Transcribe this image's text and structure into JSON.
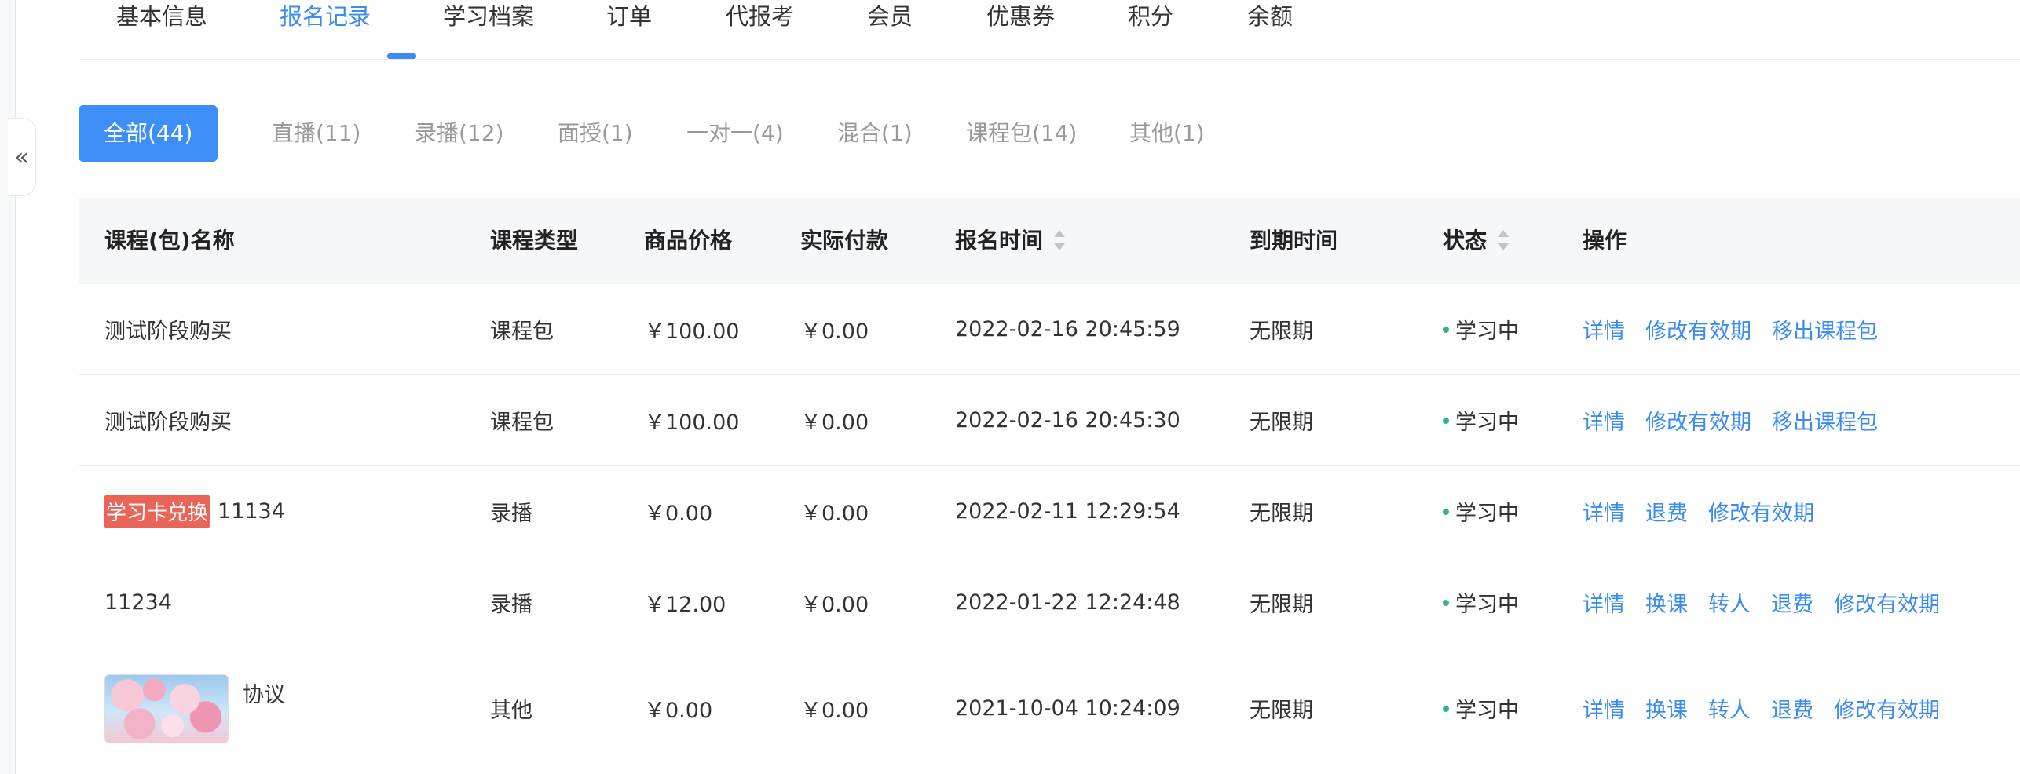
{
  "sidebar": {
    "collapse_label": "«"
  },
  "tabs": [
    {
      "label": "基本信息"
    },
    {
      "label": "报名记录"
    },
    {
      "label": "学习档案"
    },
    {
      "label": "订单"
    },
    {
      "label": "代报考"
    },
    {
      "label": "会员"
    },
    {
      "label": "优惠券"
    },
    {
      "label": "积分"
    },
    {
      "label": "余额"
    }
  ],
  "filters": [
    {
      "label": "全部(44)"
    },
    {
      "label": "直播(11)"
    },
    {
      "label": "录播(12)"
    },
    {
      "label": "面授(1)"
    },
    {
      "label": "一对一(4)"
    },
    {
      "label": "混合(1)"
    },
    {
      "label": "课程包(14)"
    },
    {
      "label": "其他(1)"
    }
  ],
  "table": {
    "headers": [
      "课程(包)名称",
      "课程类型",
      "商品价格",
      "实际付款",
      "报名时间",
      "到期时间",
      "状态",
      "操作"
    ],
    "rows": [
      {
        "name": "测试阶段购买",
        "type": "课程包",
        "price": "￥100.00",
        "paid": "￥0.00",
        "enroll_time": "2022-02-16 20:45:59",
        "expire": "无限期",
        "status": "学习中",
        "actions": [
          "详情",
          "修改有效期",
          "移出课程包"
        ]
      },
      {
        "name": "测试阶段购买",
        "type": "课程包",
        "price": "￥100.00",
        "paid": "￥0.00",
        "enroll_time": "2022-02-16 20:45:30",
        "expire": "无限期",
        "status": "学习中",
        "actions": [
          "详情",
          "修改有效期",
          "移出课程包"
        ]
      },
      {
        "badge": "学习卡兑换",
        "name": "11134",
        "type": "录播",
        "price": "￥0.00",
        "paid": "￥0.00",
        "enroll_time": "2022-02-11 12:29:54",
        "expire": "无限期",
        "status": "学习中",
        "actions": [
          "详情",
          "退费",
          "修改有效期"
        ]
      },
      {
        "name": "11234",
        "type": "录播",
        "price": "￥12.00",
        "paid": "￥0.00",
        "enroll_time": "2022-01-22 12:24:48",
        "expire": "无限期",
        "status": "学习中",
        "actions": [
          "详情",
          "换课",
          "转人",
          "退费",
          "修改有效期"
        ]
      },
      {
        "name": "协议",
        "type": "其他",
        "price": "￥0.00",
        "paid": "￥0.00",
        "enroll_time": "2021-10-04 10:24:09",
        "expire": "无限期",
        "status": "学习中",
        "actions": [
          "详情",
          "换课",
          "转人",
          "退费",
          "修改有效期"
        ]
      }
    ]
  },
  "colors": {
    "accent": "#3b8cf2",
    "status_dot": "#36b37e",
    "badge": "#e9655a"
  }
}
